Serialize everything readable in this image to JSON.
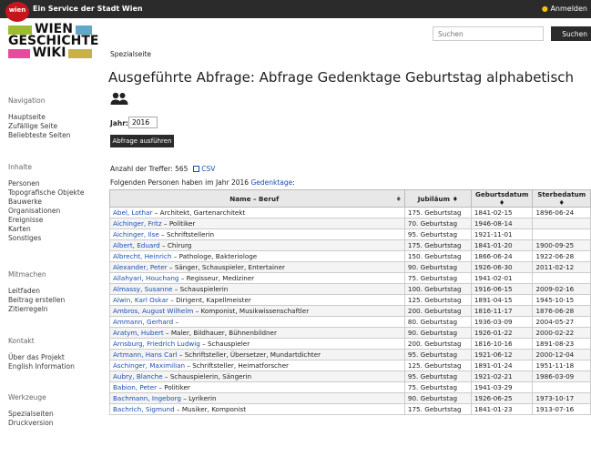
{
  "topbar": {
    "logo_text": "wien",
    "service_text": "Ein Service der Stadt Wien",
    "login_label": "Anmelden",
    "bg_color": "#2b2b2b",
    "logo_color": "#c4161c"
  },
  "wordmark": {
    "line1": "WIEN",
    "line2": "GESCHICHTE",
    "line3": "WIKI"
  },
  "search": {
    "placeholder": "Suchen",
    "button_label": "Suchen"
  },
  "page": {
    "special_label": "Spezialseite",
    "title": "Ausgeführte Abfrage: Abfrage Gedenktage Geburtstag alphabetisch",
    "jahr_label": "Jahr:",
    "jahr_value": "2016",
    "run_button_label": "Abfrage ausführen",
    "count_text": "Anzahl der Treffer: 565",
    "csv_label": "CSV",
    "follow_text": "Folgenden Personen haben im Jahr 2016",
    "follow_link": "Gedenktage",
    "follow_suffix": ":"
  },
  "sidebar": {
    "sections": [
      {
        "heading": "Navigation",
        "items": [
          "Hauptseite",
          "Zufällige Seite",
          "Beliebteste Seiten"
        ]
      },
      {
        "heading": "Inhalte",
        "items": [
          "Personen",
          "Topografische Objekte",
          "Bauwerke",
          "Organisationen",
          "Ereignisse",
          "Karten",
          "Sonstiges"
        ]
      },
      {
        "heading": "Mitmachen",
        "items": [
          "Leitfaden",
          "Beitrag erstellen",
          "Zitierregeln"
        ]
      },
      {
        "heading": "Kontakt",
        "items": [
          "Über das Projekt",
          "English Information"
        ]
      },
      {
        "heading": "Werkzeuge",
        "items": [
          "Spezialseiten",
          "Druckversion"
        ]
      }
    ]
  },
  "table": {
    "headers": [
      "Name – Beruf",
      "Jubiläum",
      "Geburtsdatum",
      "Sterbedatum"
    ],
    "rows": [
      {
        "name": "Abel, Lothar",
        "beruf": "Architekt, Gartenarchitekt",
        "jub": "175. Geburtstag",
        "geb": "1841-02-15",
        "st": "1896-06-24"
      },
      {
        "name": "Aichinger, Fritz",
        "beruf": "Politiker",
        "jub": "70. Geburtstag",
        "geb": "1946-08-14",
        "st": ""
      },
      {
        "name": "Aichinger, Ilse",
        "beruf": "Schriftstellerin",
        "jub": "95. Geburtstag",
        "geb": "1921-11-01",
        "st": ""
      },
      {
        "name": "Albert, Eduard",
        "beruf": "Chirurg",
        "jub": "175. Geburtstag",
        "geb": "1841-01-20",
        "st": "1900-09-25"
      },
      {
        "name": "Albrecht, Heinrich",
        "beruf": "Pathologe, Bakteriologe",
        "jub": "150. Geburtstag",
        "geb": "1866-06-24",
        "st": "1922-06-28"
      },
      {
        "name": "Alexander, Peter",
        "beruf": "Sänger, Schauspieler, Entertainer",
        "jub": "90. Geburtstag",
        "geb": "1926-06-30",
        "st": "2011-02-12"
      },
      {
        "name": "Allahyari, Houchang",
        "beruf": "Regisseur, Mediziner",
        "jub": "75. Geburtstag",
        "geb": "1941-02-01",
        "st": ""
      },
      {
        "name": "Almassy, Susanne",
        "beruf": "Schauspielerin",
        "jub": "100. Geburtstag",
        "geb": "1916-06-15",
        "st": "2009-02-16"
      },
      {
        "name": "Alwin, Karl Oskar",
        "beruf": "Dirigent, Kapellmeister",
        "jub": "125. Geburtstag",
        "geb": "1891-04-15",
        "st": "1945-10-15"
      },
      {
        "name": "Ambros, August Wilhelm",
        "beruf": "Komponist, Musikwissenschaftler",
        "jub": "200. Geburtstag",
        "geb": "1816-11-17",
        "st": "1876-06-28"
      },
      {
        "name": "Ammann, Gerhard",
        "beruf": "",
        "jub": "80. Geburtstag",
        "geb": "1936-03-09",
        "st": "2004-05-27"
      },
      {
        "name": "Aratym, Hubert",
        "beruf": "Maler, Bildhauer, Bühnenbildner",
        "jub": "90. Geburtstag",
        "geb": "1926-01-22",
        "st": "2000-02-22"
      },
      {
        "name": "Arnsburg, Friedrich Ludwig",
        "beruf": "Schauspieler",
        "jub": "200. Geburtstag",
        "geb": "1816-10-16",
        "st": "1891-08-23"
      },
      {
        "name": "Artmann, Hans Carl",
        "beruf": "Schriftsteller, Übersetzer, Mundartdichter",
        "jub": "95. Geburtstag",
        "geb": "1921-06-12",
        "st": "2000-12-04"
      },
      {
        "name": "Aschinger, Maximilian",
        "beruf": "Schriftsteller, Heimatforscher",
        "jub": "125. Geburtstag",
        "geb": "1891-01-24",
        "st": "1951-11-18"
      },
      {
        "name": "Aubry, Blanche",
        "beruf": "Schauspielerin, Sängerin",
        "jub": "95. Geburtstag",
        "geb": "1921-02-21",
        "st": "1986-03-09"
      },
      {
        "name": "Babion, Peter",
        "beruf": "Politiker",
        "jub": "75. Geburtstag",
        "geb": "1941-03-29",
        "st": ""
      },
      {
        "name": "Bachmann, Ingeborg",
        "beruf": "Lyrikerin",
        "jub": "90. Geburtstag",
        "geb": "1926-06-25",
        "st": "1973-10-17"
      },
      {
        "name": "Bachrich, Sigmund",
        "beruf": "Musiker, Komponist",
        "jub": "175. Geburtstag",
        "geb": "1841-01-23",
        "st": "1913-07-16"
      }
    ]
  }
}
